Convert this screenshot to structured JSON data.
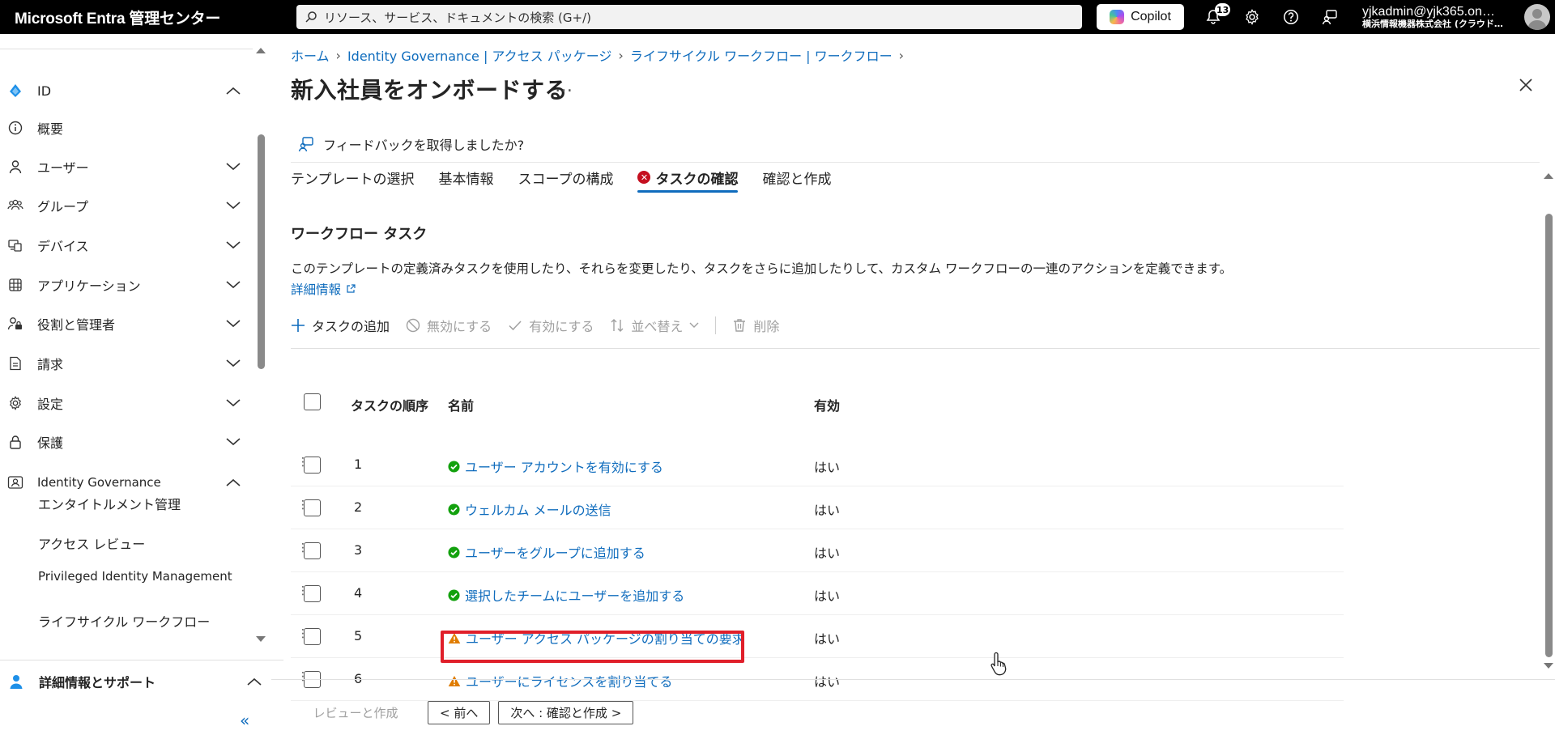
{
  "topbar": {
    "brand": "Microsoft Entra 管理センター",
    "search_placeholder": "リソース、サービス、ドキュメントの検索 (G+/)",
    "copilot_label": "Copilot",
    "notification_count": "13",
    "account_user": "yjkadmin@yjk365.on…",
    "account_org": "横浜情報機器株式会社 (クラウド…"
  },
  "sidebar": {
    "items": [
      {
        "label": "ID"
      },
      {
        "label": "概要"
      },
      {
        "label": "ユーザー"
      },
      {
        "label": "グループ"
      },
      {
        "label": "デバイス"
      },
      {
        "label": "アプリケーション"
      },
      {
        "label": "役割と管理者"
      },
      {
        "label": "請求"
      },
      {
        "label": "設定"
      },
      {
        "label": "保護"
      },
      {
        "label": "Identity Governance"
      }
    ],
    "sub_items": [
      {
        "label": "エンタイトルメント管理"
      },
      {
        "label": "アクセス レビュー"
      },
      {
        "label": "Privileged Identity Management"
      },
      {
        "label": "ライフサイクル ワークフロー"
      }
    ],
    "help_label": "詳細情報とサポート",
    "collapse_label": "«"
  },
  "breadcrumb": [
    "ホーム",
    "Identity Governance | アクセス パッケージ",
    "ライフサイクル ワークフロー | ワークフロー"
  ],
  "page_title": "新入社員をオンボードする",
  "title_more": "…",
  "feedback_label": "フィードバックを取得しましたか?",
  "tabs": [
    {
      "label": "テンプレートの選択"
    },
    {
      "label": "基本情報"
    },
    {
      "label": "スコープの構成"
    },
    {
      "label": "タスクの確認"
    },
    {
      "label": "確認と作成"
    }
  ],
  "section_title": "ワークフロー タスク",
  "description": "このテンプレートの定義済みタスクを使用したり、それらを変更したり、タスクをさらに追加したりして、カスタム ワークフローの一連のアクションを定義できます。",
  "more_info_link": "詳細情報",
  "toolbar": {
    "add": "タスクの追加",
    "disable": "無効にする",
    "enable": "有効にする",
    "sort": "並べ替え",
    "delete": "削除"
  },
  "table": {
    "headers": {
      "order": "タスクの順序",
      "name": "名前",
      "enabled": "有効"
    },
    "rows": [
      {
        "order": "1",
        "name": "ユーザー アカウントを有効にする",
        "enabled": "はい",
        "status": "ok"
      },
      {
        "order": "2",
        "name": "ウェルカム メールの送信",
        "enabled": "はい",
        "status": "ok"
      },
      {
        "order": "3",
        "name": "ユーザーをグループに追加する",
        "enabled": "はい",
        "status": "ok"
      },
      {
        "order": "4",
        "name": "選択したチームにユーザーを追加する",
        "enabled": "はい",
        "status": "ok"
      },
      {
        "order": "5",
        "name": "ユーザー アクセス パッケージの割り当ての要求",
        "enabled": "はい",
        "status": "warning"
      },
      {
        "order": "6",
        "name": "ユーザーにライセンスを割り当てる",
        "enabled": "はい",
        "status": "warning"
      }
    ]
  },
  "footer": {
    "review_create": "レビューと作成",
    "prev": "< 前へ",
    "next": "次へ : 確認と作成 >"
  },
  "colors": {
    "accent": "#0f6cbd",
    "ok": "#13a10e",
    "warning": "#e07c00",
    "error": "#c50f1f",
    "highlight": "#e01f2a"
  }
}
